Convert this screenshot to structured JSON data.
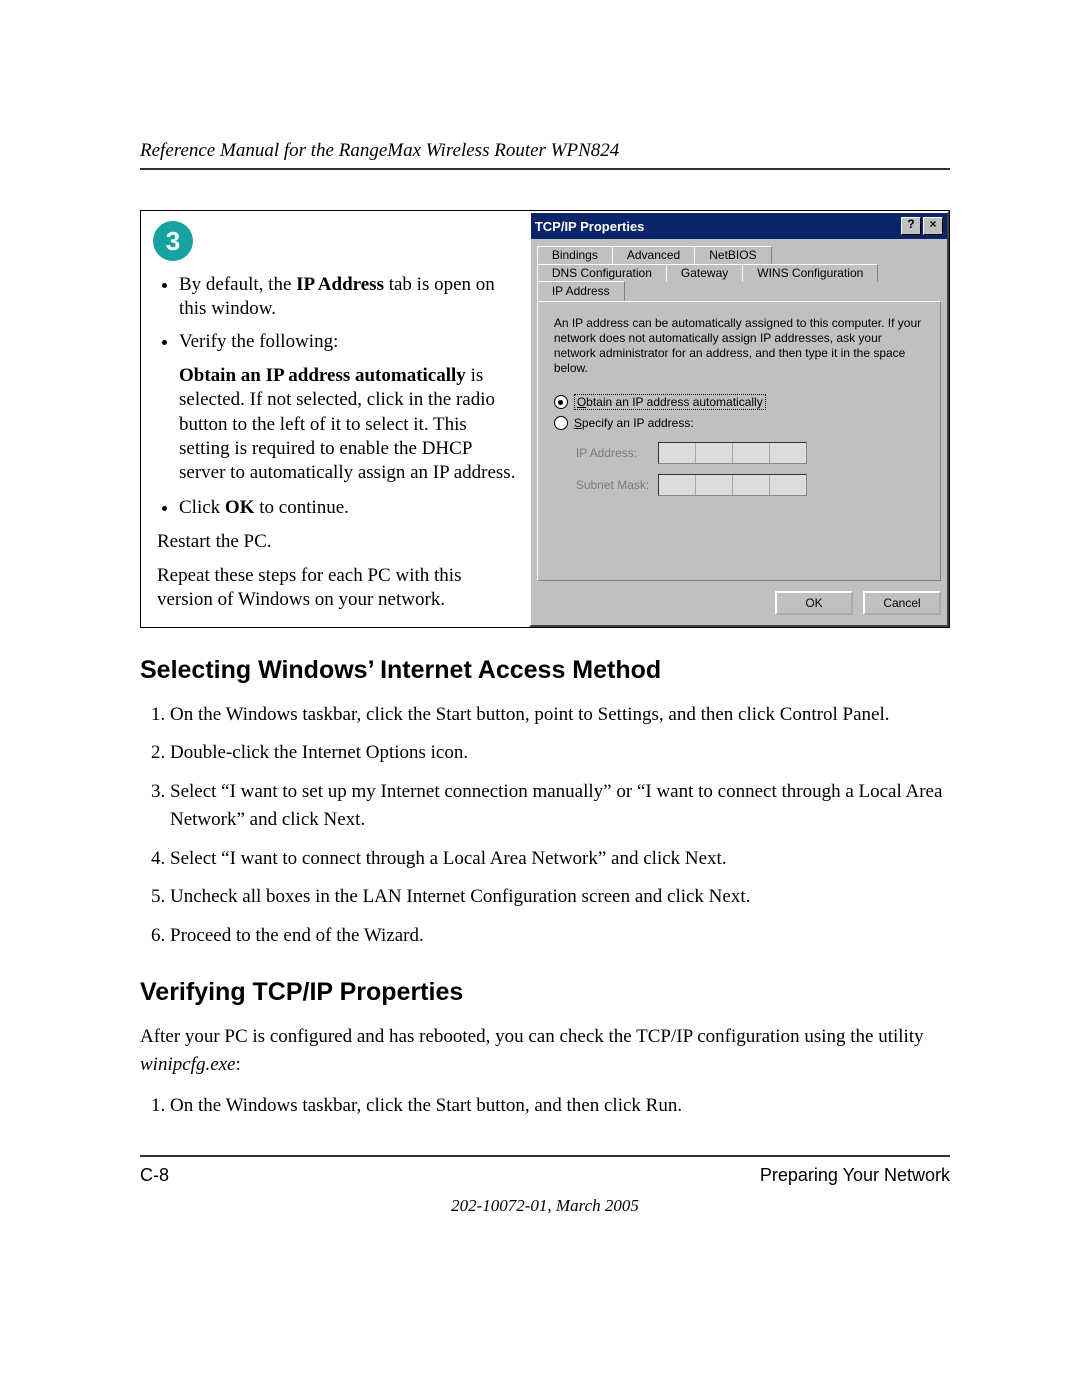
{
  "header": {
    "running_title": "Reference Manual for the RangeMax Wireless Router WPN824"
  },
  "step": {
    "number": "3",
    "bullet1_a": "By default, the ",
    "bullet1_b_bold": "IP Address",
    "bullet1_c": " tab is open on this window.",
    "bullet2": "Verify the following:",
    "para1_bold": "Obtain an IP address automatically",
    "para1_rest": " is selected. If not selected, click in the radio button to the left of it to select it.  This setting is required to enable the DHCP server to automatically assign an IP address.",
    "bullet3_a": "Click ",
    "bullet3_b_bold": "OK",
    "bullet3_c": " to continue.",
    "after1": "Restart the PC.",
    "after2": "Repeat these steps for each PC with this version of Windows on your network."
  },
  "dialog": {
    "title": "TCP/IP Properties",
    "help_btn": "?",
    "close_btn": "×",
    "tabs_row1": [
      "Bindings",
      "Advanced",
      "NetBIOS"
    ],
    "tabs_row2": [
      "DNS Configuration",
      "Gateway",
      "WINS Configuration",
      "IP Address"
    ],
    "active_tab": "IP Address",
    "blurb": "An IP address can be automatically assigned to this computer. If your network does not automatically assign IP addresses, ask your network administrator for an address, and then type it in the space below.",
    "radio_auto_pre": "O",
    "radio_auto_rest": "btain an IP address automatically",
    "radio_spec_pre": "S",
    "radio_spec_rest": "pecify an IP address:",
    "field_ip": "IP Address:",
    "field_mask": "Subnet Mask:",
    "ok": "OK",
    "cancel": "Cancel"
  },
  "sections": {
    "h2a": "Selecting Windows’ Internet Access Method",
    "steps_a": [
      "On the Windows taskbar, click the Start button, point to Settings, and then click Control Panel.",
      "Double-click the Internet Options icon.",
      "Select “I want to set up my Internet connection manually” or “I want to connect through a Local Area Network” and click Next.",
      "Select “I want to connect through a Local Area Network” and click Next.",
      "Uncheck all boxes in the LAN Internet Configuration screen and click Next.",
      "Proceed to the end of the Wizard."
    ],
    "h2b": "Verifying TCP/IP Properties",
    "para_b_a": "After your PC is configured and has rebooted, you can check the TCP/IP configuration using the utility ",
    "para_b_cmd": "winipcfg.exe",
    "para_b_c": ":",
    "steps_b": [
      "On the Windows taskbar, click the Start button, and then click Run."
    ]
  },
  "footer": {
    "left": "C-8",
    "right": "Preparing Your Network",
    "pub": "202-10072-01, March 2005"
  }
}
